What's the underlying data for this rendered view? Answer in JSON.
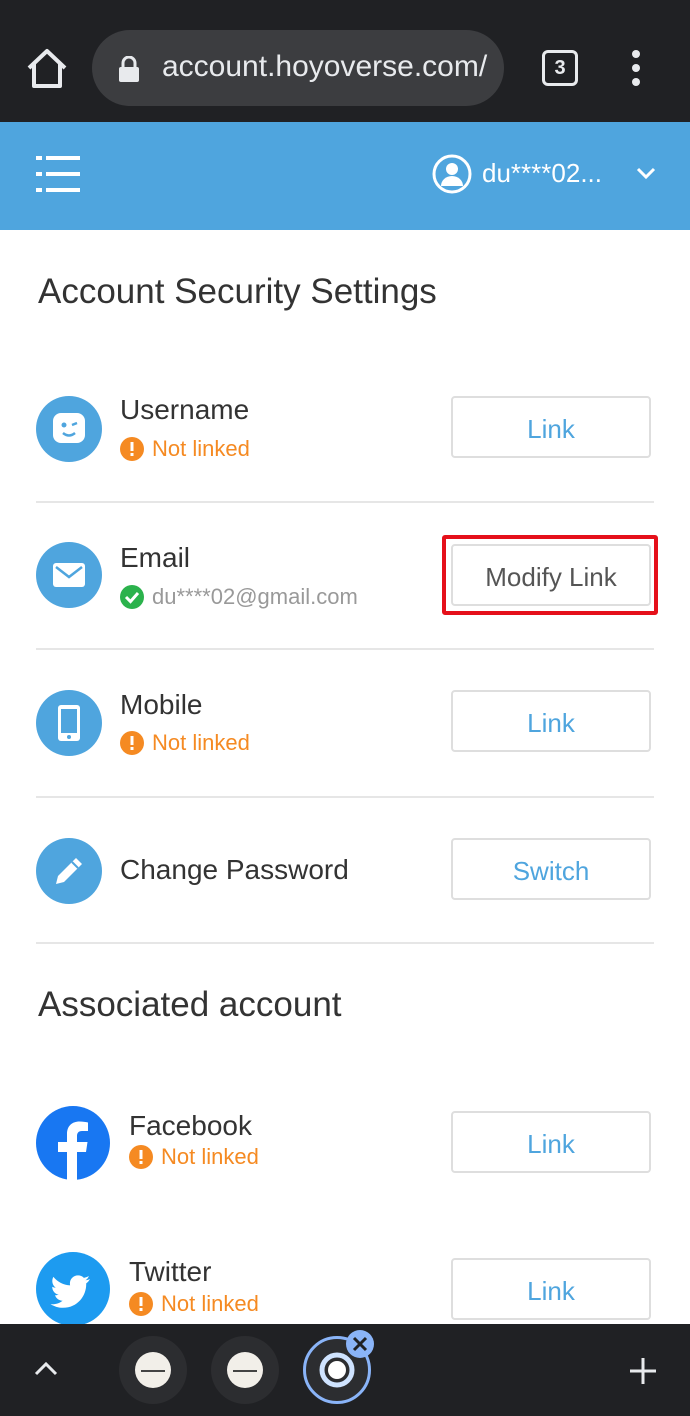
{
  "browser": {
    "url": "account.hoyoverse.com/",
    "tab_count": "3"
  },
  "header": {
    "username": "du****02..."
  },
  "security": {
    "title": "Account Security Settings",
    "rows": [
      {
        "label": "Username",
        "status": "Not linked",
        "status_type": "warning",
        "button": "Link",
        "icon": "face-icon"
      },
      {
        "label": "Email",
        "status": "du****02@gmail.com",
        "status_type": "ok",
        "button": "Modify Link",
        "icon": "envelope-icon"
      },
      {
        "label": "Mobile",
        "status": "Not linked",
        "status_type": "warning",
        "button": "Link",
        "icon": "phone-icon"
      },
      {
        "label": "Change Password",
        "status": "",
        "button": "Switch",
        "icon": "pencil-icon"
      }
    ]
  },
  "associated": {
    "title": "Associated account",
    "rows": [
      {
        "label": "Facebook",
        "status": "Not linked",
        "button": "Link",
        "icon": "facebook-icon"
      },
      {
        "label": "Twitter",
        "status": "Not linked",
        "button": "Link",
        "icon": "twitter-icon"
      }
    ]
  },
  "colors": {
    "brand_blue": "#4fa5de",
    "warning": "#f58a22",
    "ok": "#2bb24c",
    "highlight": "#e5101a"
  }
}
